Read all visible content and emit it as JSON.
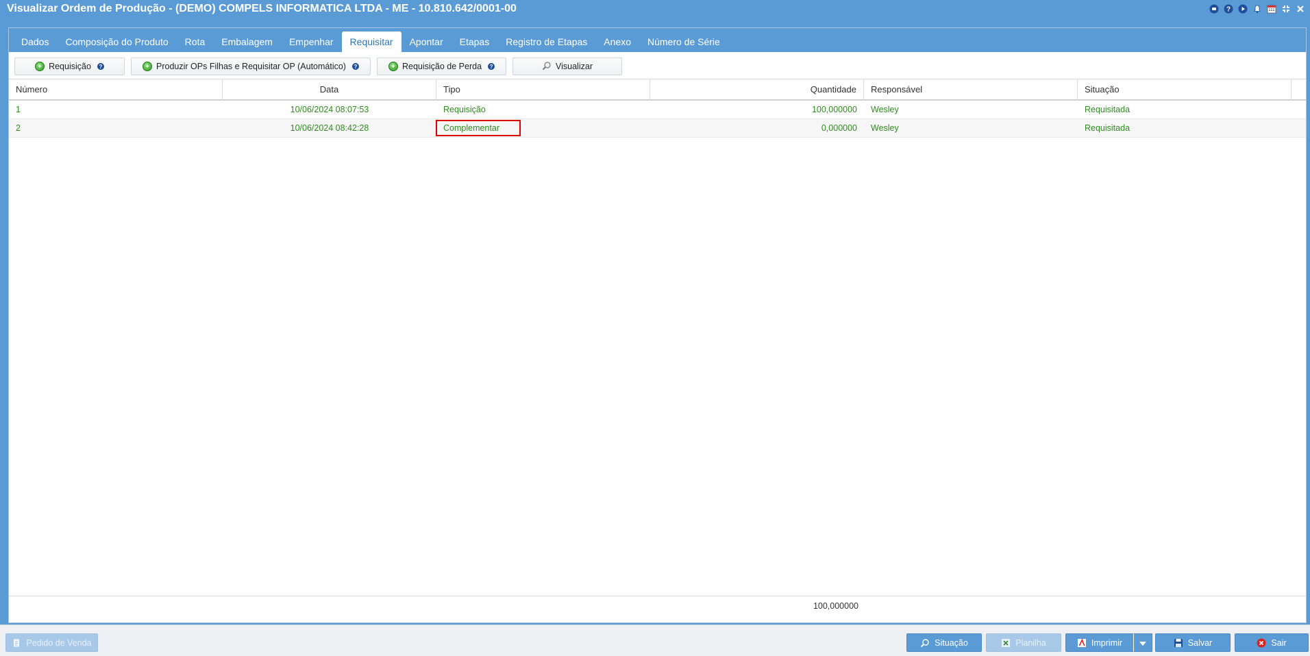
{
  "window": {
    "title": "Visualizar Ordem de Produção - (DEMO) COMPELS INFORMATICA LTDA - ME - 10.810.642/0001-00"
  },
  "tabs": [
    {
      "label": "Dados",
      "active": false
    },
    {
      "label": "Composição do Produto",
      "active": false
    },
    {
      "label": "Rota",
      "active": false
    },
    {
      "label": "Embalagem",
      "active": false
    },
    {
      "label": "Empenhar",
      "active": false
    },
    {
      "label": "Requisitar",
      "active": true
    },
    {
      "label": "Apontar",
      "active": false
    },
    {
      "label": "Etapas",
      "active": false
    },
    {
      "label": "Registro de Etapas",
      "active": false
    },
    {
      "label": "Anexo",
      "active": false
    },
    {
      "label": "Número de Série",
      "active": false
    }
  ],
  "toolbar": {
    "requisicao": "Requisição",
    "produzir": "Produzir OPs Filhas e Requisitar OP (Automático)",
    "perda": "Requisição de Perda",
    "visualizar": "Visualizar",
    "help_glyph": "?"
  },
  "grid": {
    "columns": [
      "Número",
      "Data",
      "Tipo",
      "Quantidade",
      "Responsável",
      "Situação"
    ],
    "rows": [
      {
        "numero": "1",
        "data": "10/06/2024 08:07:53",
        "tipo": "Requisição",
        "quantidade": "100,000000",
        "responsavel": "Wesley",
        "situacao": "Requisitada"
      },
      {
        "numero": "2",
        "data": "10/06/2024 08:42:28",
        "tipo": "Complementar",
        "quantidade": "0,000000",
        "responsavel": "Wesley",
        "situacao": "Requisitada"
      }
    ],
    "total_quantidade": "100,000000"
  },
  "bottom": {
    "pedido_venda": "Pedido de Venda",
    "situacao": "Situação",
    "planilha": "Planilha",
    "imprimir": "Imprimir",
    "salvar": "Salvar",
    "sair": "Sair"
  },
  "colors": {
    "accent": "#5b9bd5",
    "row_text": "#2e8b1e",
    "highlight": "#e00000"
  },
  "icons": {
    "title_icons": [
      "chat-icon",
      "help-icon",
      "play-icon",
      "bell-icon",
      "calendar-icon",
      "collapse-icon",
      "close-icon"
    ]
  }
}
